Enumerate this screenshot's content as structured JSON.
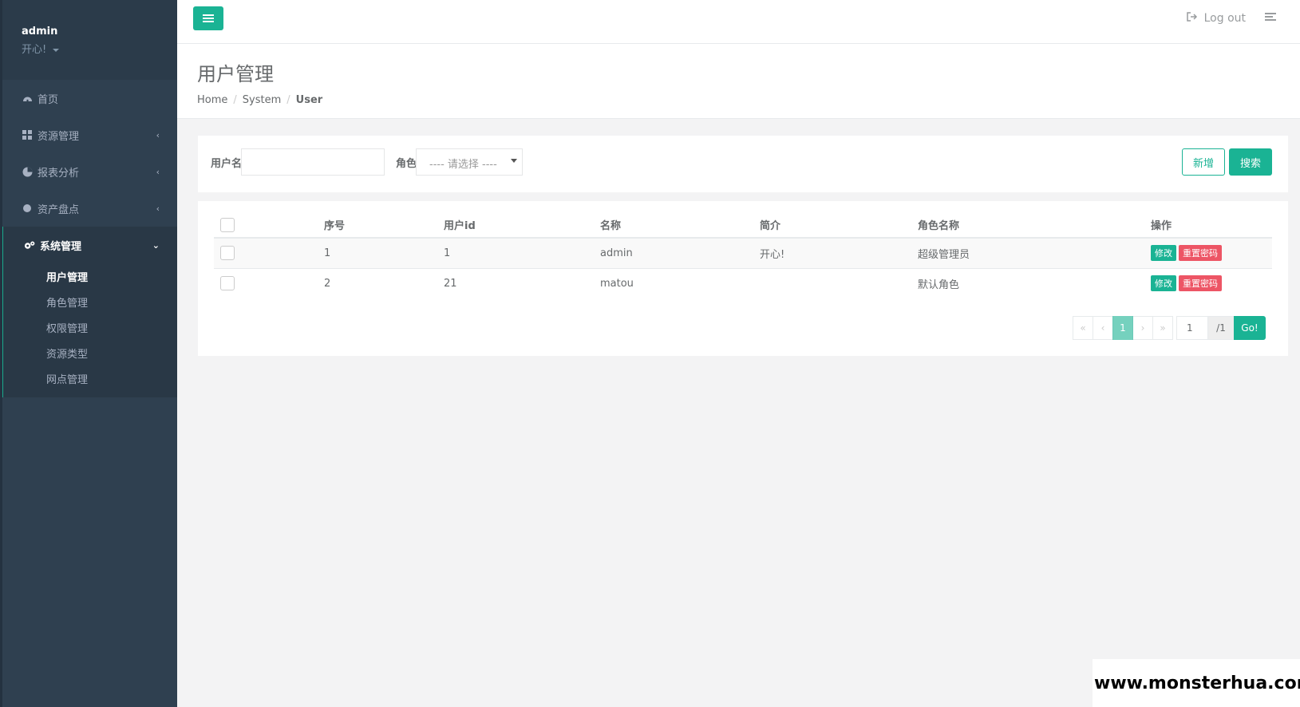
{
  "profile": {
    "name": "admin",
    "motto": "开心!"
  },
  "sidebar": {
    "items": [
      {
        "label": "首页",
        "icon": "dashboard-icon"
      },
      {
        "label": "资源管理",
        "icon": "grid-icon"
      },
      {
        "label": "报表分析",
        "icon": "pie-chart-icon"
      },
      {
        "label": "资产盘点",
        "icon": "circle-icon"
      }
    ],
    "group": {
      "label": "系统管理",
      "icon": "gears-icon",
      "sub": [
        "用户管理",
        "角色管理",
        "权限管理",
        "资源类型",
        "网点管理"
      ]
    }
  },
  "topbar": {
    "logout": "Log out"
  },
  "heading": {
    "title": "用户管理",
    "breadcrumb": [
      "Home",
      "System",
      "User"
    ]
  },
  "search": {
    "username_label": "用户名",
    "username_value": "",
    "role_label": "角色",
    "role_selected": "---- 请选择 ----",
    "add_label": "新增",
    "search_label": "搜索"
  },
  "table": {
    "headers": [
      "序号",
      "用户id",
      "名称",
      "简介",
      "角色名称",
      "操作"
    ],
    "rows": [
      {
        "no": "1",
        "id": "1",
        "name": "admin",
        "intro": "开心!",
        "role": "超级管理员"
      },
      {
        "no": "2",
        "id": "21",
        "name": "matou",
        "intro": "",
        "role": "默认角色"
      }
    ],
    "edit_label": "修改",
    "reset_label": "重置密码"
  },
  "pagination": {
    "first": "«",
    "prev": "‹",
    "current": "1",
    "next": "›",
    "last": "»",
    "page_input": "1",
    "total": "/1",
    "go": "Go!"
  },
  "watermark": "www.monsterhua.com",
  "colors": {
    "primary": "#1ab394",
    "danger": "#ed5565",
    "sidebar": "#2f4050"
  }
}
